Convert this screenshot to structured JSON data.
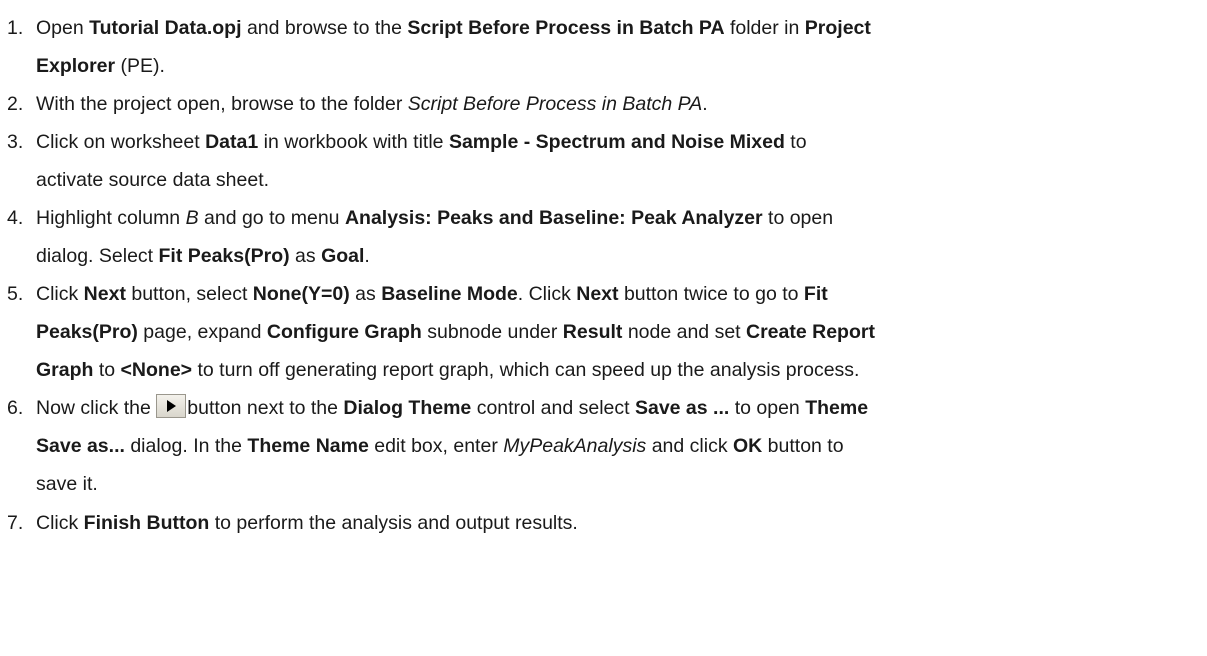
{
  "steps": [
    {
      "number": "1.",
      "lines": [
        [
          {
            "t": "Open ",
            "s": "n"
          },
          {
            "t": "Tutorial Data.opj",
            "s": "b"
          },
          {
            "t": " and browse to the ",
            "s": "n"
          },
          {
            "t": "Script Before Process in Batch PA",
            "s": "b"
          },
          {
            "t": " folder in ",
            "s": "n"
          },
          {
            "t": "Project",
            "s": "b"
          }
        ],
        [
          {
            "t": "Explorer",
            "s": "b"
          },
          {
            "t": " (PE).",
            "s": "n"
          }
        ]
      ]
    },
    {
      "number": "2.",
      "lines": [
        [
          {
            "t": "With the project open, browse to the folder ",
            "s": "n"
          },
          {
            "t": "Script Before Process in Batch PA",
            "s": "i"
          },
          {
            "t": ".",
            "s": "n"
          }
        ]
      ]
    },
    {
      "number": "3.",
      "lines": [
        [
          {
            "t": "Click on worksheet ",
            "s": "n"
          },
          {
            "t": "Data1",
            "s": "b"
          },
          {
            "t": " in workbook with title ",
            "s": "n"
          },
          {
            "t": "Sample - Spectrum and Noise Mixed",
            "s": "b"
          },
          {
            "t": " to",
            "s": "n"
          }
        ],
        [
          {
            "t": "activate source data sheet.",
            "s": "n"
          }
        ]
      ]
    },
    {
      "number": "4.",
      "lines": [
        [
          {
            "t": "Highlight column ",
            "s": "n"
          },
          {
            "t": "B",
            "s": "i"
          },
          {
            "t": " and go to menu ",
            "s": "n"
          },
          {
            "t": "Analysis: Peaks and Baseline: Peak Analyzer",
            "s": "b"
          },
          {
            "t": " to open",
            "s": "n"
          }
        ],
        [
          {
            "t": "dialog. Select ",
            "s": "n"
          },
          {
            "t": "Fit Peaks(Pro)",
            "s": "b"
          },
          {
            "t": " as ",
            "s": "n"
          },
          {
            "t": "Goal",
            "s": "b"
          },
          {
            "t": ".",
            "s": "n"
          }
        ]
      ]
    },
    {
      "number": "5.",
      "lines": [
        [
          {
            "t": "Click ",
            "s": "n"
          },
          {
            "t": "Next",
            "s": "b"
          },
          {
            "t": " button, select ",
            "s": "n"
          },
          {
            "t": "None(Y=0)",
            "s": "b"
          },
          {
            "t": " as ",
            "s": "n"
          },
          {
            "t": "Baseline Mode",
            "s": "b"
          },
          {
            "t": ". Click ",
            "s": "n"
          },
          {
            "t": "Next",
            "s": "b"
          },
          {
            "t": " button twice to go to ",
            "s": "n"
          },
          {
            "t": "Fit",
            "s": "b"
          }
        ],
        [
          {
            "t": "Peaks(Pro)",
            "s": "b"
          },
          {
            "t": " page, expand ",
            "s": "n"
          },
          {
            "t": "Configure Graph",
            "s": "b"
          },
          {
            "t": " subnode under ",
            "s": "n"
          },
          {
            "t": "Result",
            "s": "b"
          },
          {
            "t": " node and set ",
            "s": "n"
          },
          {
            "t": "Create Report",
            "s": "b"
          }
        ],
        [
          {
            "t": "Graph",
            "s": "b"
          },
          {
            "t": " to ",
            "s": "n"
          },
          {
            "t": "<None>",
            "s": "b"
          },
          {
            "t": " to turn off generating report graph, which can speed up the analysis process.",
            "s": "n"
          }
        ]
      ]
    },
    {
      "number": "6.",
      "lines": [
        [
          {
            "t": "Now click the ",
            "s": "n"
          },
          {
            "t": "",
            "s": "icon",
            "icon": "play-arrow-icon"
          },
          {
            "t": "button next to the ",
            "s": "n"
          },
          {
            "t": "Dialog Theme",
            "s": "b"
          },
          {
            "t": " control and select ",
            "s": "n"
          },
          {
            "t": "Save as ...",
            "s": "b"
          },
          {
            "t": " to open ",
            "s": "n"
          },
          {
            "t": "Theme",
            "s": "b"
          }
        ],
        [
          {
            "t": "Save as...",
            "s": "b"
          },
          {
            "t": " dialog. In the ",
            "s": "n"
          },
          {
            "t": "Theme Name",
            "s": "b"
          },
          {
            "t": " edit box, enter ",
            "s": "n"
          },
          {
            "t": "MyPeakAnalysis",
            "s": "i"
          },
          {
            "t": " and click ",
            "s": "n"
          },
          {
            "t": "OK",
            "s": "b"
          },
          {
            "t": " button to",
            "s": "n"
          }
        ],
        [
          {
            "t": "save it.",
            "s": "n"
          }
        ]
      ]
    },
    {
      "number": "7.",
      "lines": [
        [
          {
            "t": "Click ",
            "s": "n"
          },
          {
            "t": "Finish Button",
            "s": "b"
          },
          {
            "t": " to perform the analysis and output results.",
            "s": "n"
          }
        ]
      ]
    }
  ]
}
